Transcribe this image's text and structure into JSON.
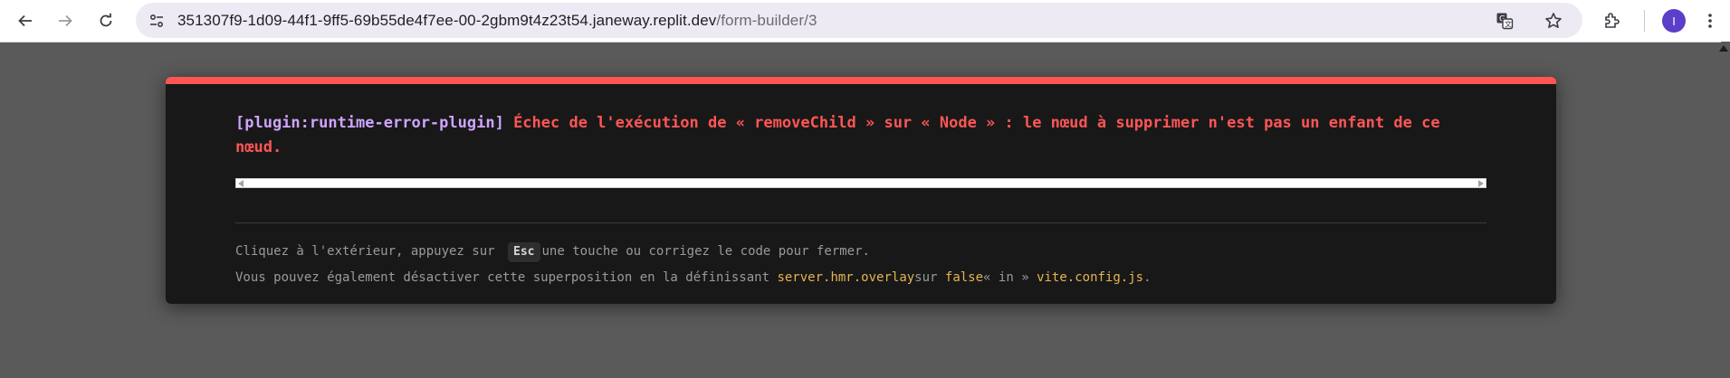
{
  "browser": {
    "url_host": "351307f9-1d09-44f1-9ff5-69b55de4f7ee-00-2gbm9t4z23t54.janeway.replit.dev",
    "url_path": "/form-builder/3",
    "avatar_initial": "I",
    "icons": [
      "back-icon",
      "forward-icon",
      "reload-icon",
      "site-info-icon",
      "translate-icon",
      "star-icon",
      "extensions-icon",
      "avatar",
      "more-icon"
    ]
  },
  "overlay": {
    "accent_color": "#ff5555",
    "plugin": "[plugin:runtime-error-plugin]",
    "message": "Échec de l'exécution de « removeChild » sur « Node » : le nœud à supprimer n'est pas un enfant de ce nœud.",
    "tip1_before": "Cliquez à l'extérieur, appuyez sur ",
    "tip1_key": "Esc",
    "tip1_after": "une touche ou corrigez le code pour fermer.",
    "tip2_before": "Vous pouvez également désactiver cette superposition en la définissant ",
    "tip2_code1": "server.hmr.overlay",
    "tip2_mid": "sur ",
    "tip2_code2": "false",
    "tip2_mid2": "« in » ",
    "tip2_code3": "vite.config.js",
    "tip2_end": "."
  }
}
